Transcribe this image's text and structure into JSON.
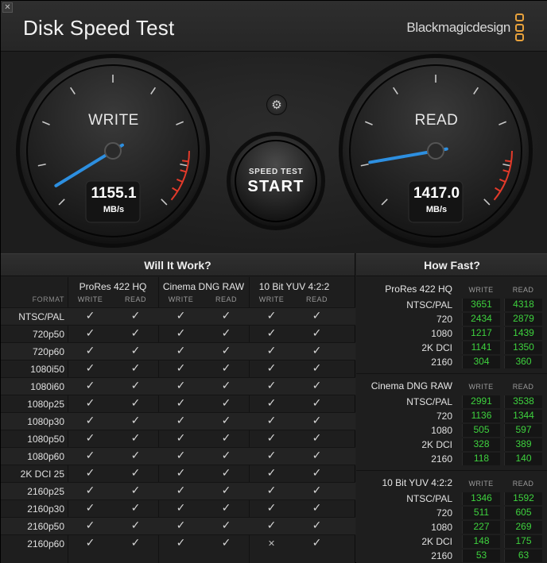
{
  "window": {
    "close_glyph": "✕",
    "title": "Disk Speed Test",
    "brand": "Blackmagicdesign"
  },
  "colors": {
    "accent_needle": "#2d8fe0",
    "redline": "#e23a2a",
    "ok_green": "#3ed23e",
    "brand_orange": "#e8a23c"
  },
  "gauges": {
    "write": {
      "label": "WRITE",
      "value": "1155.1",
      "unit": "MB/s",
      "needle_fraction": 0.05
    },
    "read": {
      "label": "READ",
      "value": "1417.0",
      "unit": "MB/s",
      "needle_fraction": 0.13
    }
  },
  "start_button": {
    "small": "SPEED TEST",
    "big": "START"
  },
  "settings_icon": "gear-icon",
  "will_it_work": {
    "title": "Will It Work?",
    "format_header": "FORMAT",
    "groups": [
      "ProRes 422 HQ",
      "Cinema DNG RAW",
      "10 Bit YUV 4:2:2"
    ],
    "sub_write": "WRITE",
    "sub_read": "READ",
    "rows": [
      {
        "format": "NTSC/PAL",
        "cells": [
          "✓",
          "✓",
          "✓",
          "✓",
          "✓",
          "✓"
        ]
      },
      {
        "format": "720p50",
        "cells": [
          "✓",
          "✓",
          "✓",
          "✓",
          "✓",
          "✓"
        ]
      },
      {
        "format": "720p60",
        "cells": [
          "✓",
          "✓",
          "✓",
          "✓",
          "✓",
          "✓"
        ]
      },
      {
        "format": "1080i50",
        "cells": [
          "✓",
          "✓",
          "✓",
          "✓",
          "✓",
          "✓"
        ]
      },
      {
        "format": "1080i60",
        "cells": [
          "✓",
          "✓",
          "✓",
          "✓",
          "✓",
          "✓"
        ]
      },
      {
        "format": "1080p25",
        "cells": [
          "✓",
          "✓",
          "✓",
          "✓",
          "✓",
          "✓"
        ]
      },
      {
        "format": "1080p30",
        "cells": [
          "✓",
          "✓",
          "✓",
          "✓",
          "✓",
          "✓"
        ]
      },
      {
        "format": "1080p50",
        "cells": [
          "✓",
          "✓",
          "✓",
          "✓",
          "✓",
          "✓"
        ]
      },
      {
        "format": "1080p60",
        "cells": [
          "✓",
          "✓",
          "✓",
          "✓",
          "✓",
          "✓"
        ]
      },
      {
        "format": "2K DCI 25",
        "cells": [
          "✓",
          "✓",
          "✓",
          "✓",
          "✓",
          "✓"
        ]
      },
      {
        "format": "2160p25",
        "cells": [
          "✓",
          "✓",
          "✓",
          "✓",
          "✓",
          "✓"
        ]
      },
      {
        "format": "2160p30",
        "cells": [
          "✓",
          "✓",
          "✓",
          "✓",
          "✓",
          "✓"
        ]
      },
      {
        "format": "2160p50",
        "cells": [
          "✓",
          "✓",
          "✓",
          "✓",
          "✓",
          "✓"
        ]
      },
      {
        "format": "2160p60",
        "cells": [
          "✓",
          "✓",
          "✓",
          "✓",
          "✕",
          "✓"
        ]
      }
    ]
  },
  "how_fast": {
    "title": "How Fast?",
    "write_header": "WRITE",
    "read_header": "READ",
    "groups": [
      {
        "name": "ProRes 422 HQ",
        "rows": [
          {
            "res": "NTSC/PAL",
            "write": "3651",
            "read": "4318"
          },
          {
            "res": "720",
            "write": "2434",
            "read": "2879"
          },
          {
            "res": "1080",
            "write": "1217",
            "read": "1439"
          },
          {
            "res": "2K DCI",
            "write": "1141",
            "read": "1350"
          },
          {
            "res": "2160",
            "write": "304",
            "read": "360"
          }
        ]
      },
      {
        "name": "Cinema DNG RAW",
        "rows": [
          {
            "res": "NTSC/PAL",
            "write": "2991",
            "read": "3538"
          },
          {
            "res": "720",
            "write": "1136",
            "read": "1344"
          },
          {
            "res": "1080",
            "write": "505",
            "read": "597"
          },
          {
            "res": "2K DCI",
            "write": "328",
            "read": "389"
          },
          {
            "res": "2160",
            "write": "118",
            "read": "140"
          }
        ]
      },
      {
        "name": "10 Bit YUV 4:2:2",
        "rows": [
          {
            "res": "NTSC/PAL",
            "write": "1346",
            "read": "1592"
          },
          {
            "res": "720",
            "write": "511",
            "read": "605"
          },
          {
            "res": "1080",
            "write": "227",
            "read": "269"
          },
          {
            "res": "2K DCI",
            "write": "148",
            "read": "175"
          },
          {
            "res": "2160",
            "write": "53",
            "read": "63"
          }
        ]
      }
    ]
  }
}
